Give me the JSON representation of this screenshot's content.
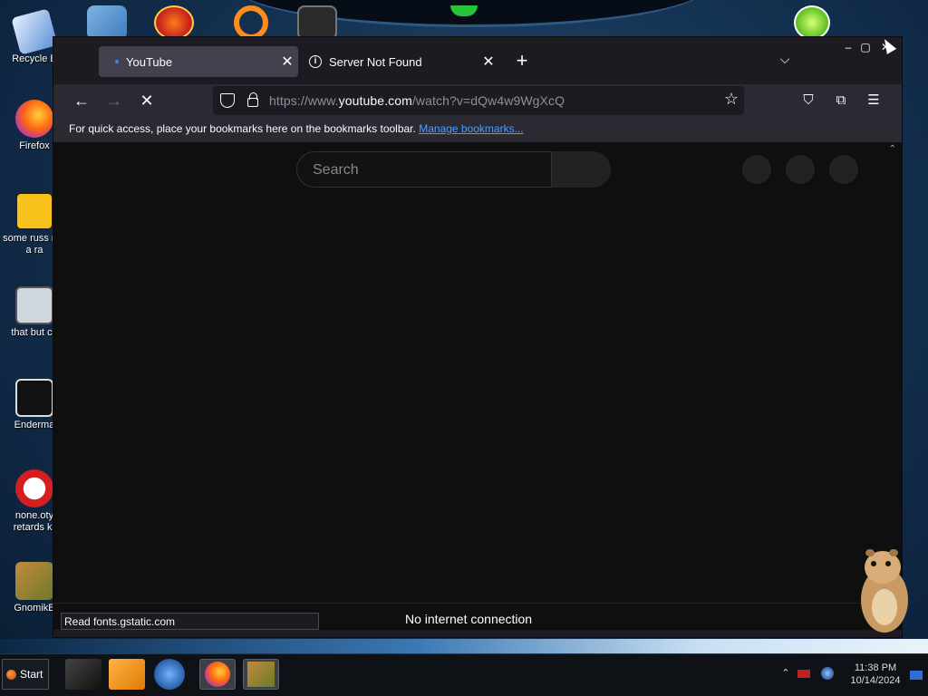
{
  "desktop": {
    "icons": [
      {
        "label": "Recycle B"
      },
      {
        "label": "Firefox"
      },
      {
        "label": "some russ ran a ra"
      },
      {
        "label": "that but c#"
      },
      {
        "label": "Enderma"
      },
      {
        "label": "none.oty retards kr"
      },
      {
        "label": "GnomikB"
      }
    ]
  },
  "browser": {
    "tabs": [
      {
        "label": "YouTube",
        "active": true
      },
      {
        "label": "Server Not Found",
        "active": false
      }
    ],
    "url": {
      "prefix": "https://www.",
      "host": "youtube.com",
      "path": "/watch?v=dQw4w9WgXcQ"
    },
    "bookmarks_bar": {
      "text": "For quick access, place your bookmarks here on the bookmarks toolbar.",
      "link": "Manage bookmarks..."
    },
    "page": {
      "search_placeholder": "Search"
    },
    "status": {
      "loading_text": "Read fonts.gstatic.com",
      "connection": "No internet connection"
    }
  },
  "taskbar": {
    "start_label": "Start",
    "time": "11:38 PM",
    "date": "10/14/2024"
  }
}
